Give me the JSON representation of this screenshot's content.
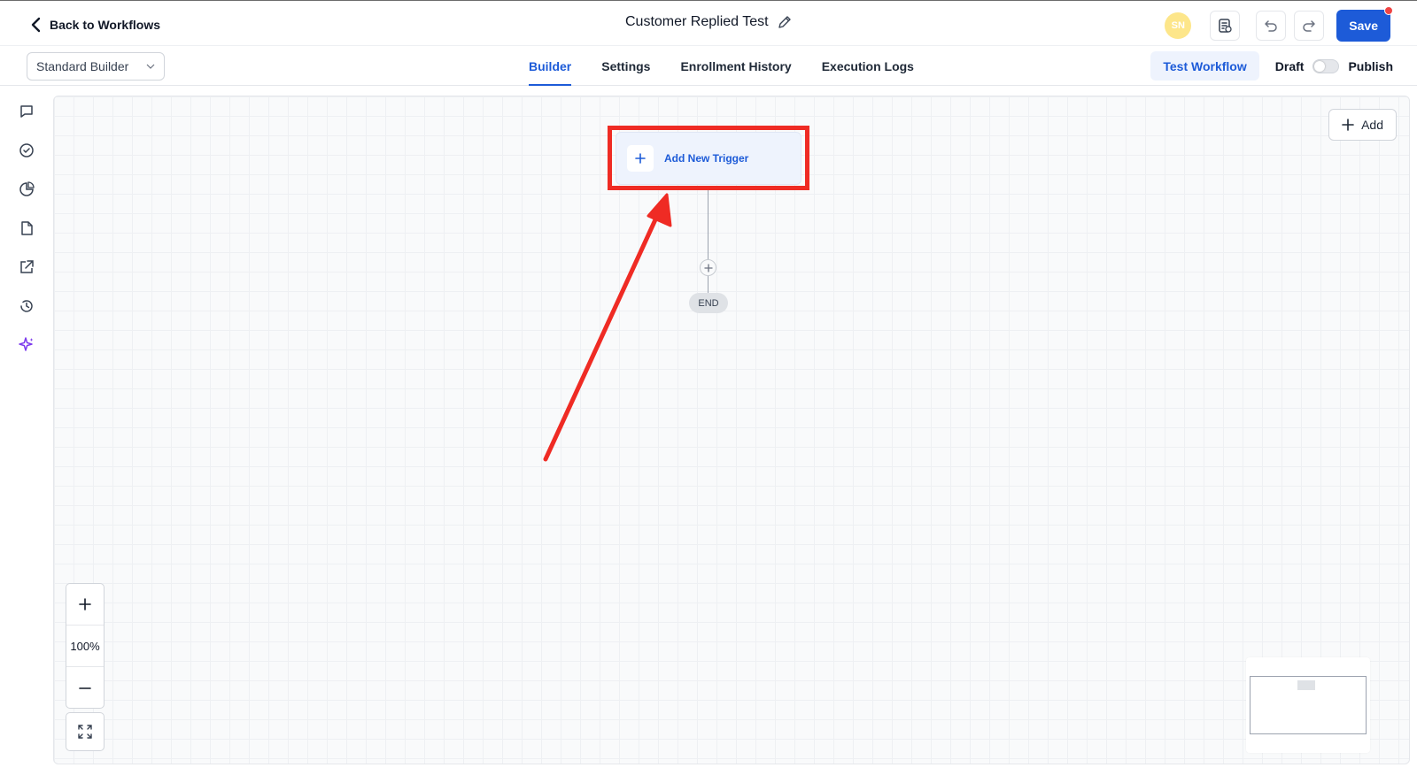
{
  "topbar": {
    "back_label": "Back to Workflows",
    "title": "Customer Replied Test",
    "avatar_initials": "SN",
    "save_label": "Save"
  },
  "subbar": {
    "builder_select": "Standard Builder",
    "tabs": [
      {
        "label": "Builder",
        "active": true
      },
      {
        "label": "Settings",
        "active": false
      },
      {
        "label": "Enrollment History",
        "active": false
      },
      {
        "label": "Execution Logs",
        "active": false
      }
    ],
    "test_label": "Test Workflow",
    "draft_label": "Draft",
    "publish_label": "Publish"
  },
  "rail": {
    "icons": [
      "message-icon",
      "check-circle-icon",
      "pie-chart-icon",
      "file-icon",
      "external-link-icon",
      "history-icon",
      "sparkle-icon"
    ]
  },
  "canvas": {
    "add_label": "Add",
    "trigger_label": "Add New Trigger",
    "end_label": "END",
    "zoom_level": "100%"
  },
  "colors": {
    "accent": "#1d5bd8",
    "highlight": "#ef2b24",
    "sparkle": "#7c3aed"
  }
}
